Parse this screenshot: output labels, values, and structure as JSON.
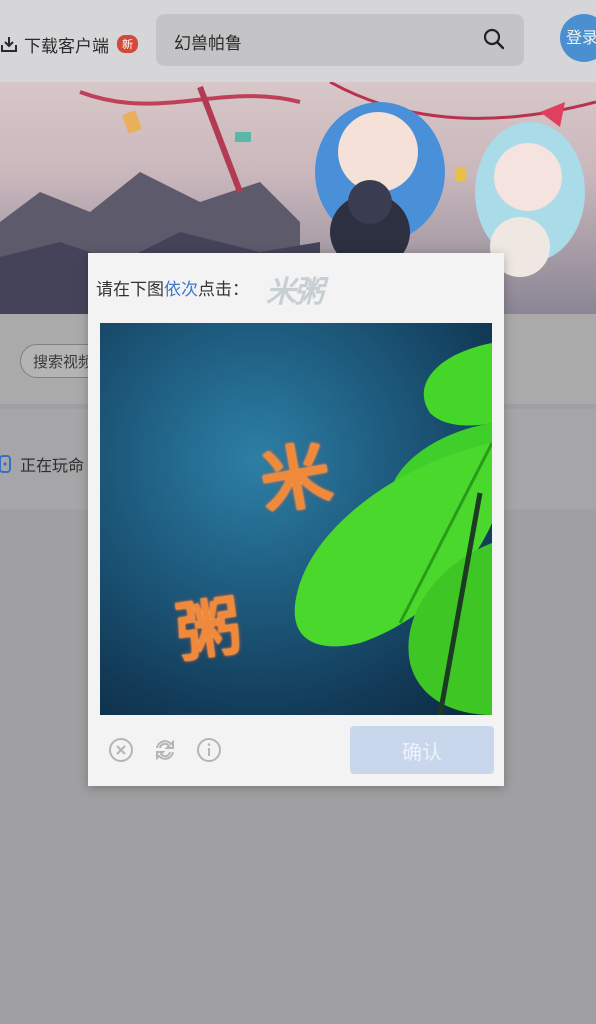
{
  "header": {
    "download_label": "下载客户端",
    "new_badge": "新",
    "search_query": "幻兽帕鲁",
    "login_label": "登录"
  },
  "page": {
    "search_pill_label": "搜索视频",
    "playing_label": "正在玩命"
  },
  "captcha": {
    "prompt_prefix": "请在下图",
    "prompt_highlight": "依次",
    "prompt_suffix": "点击：",
    "target_chars": "米粥",
    "image_chars": [
      "米",
      "粥"
    ],
    "confirm_label": "确认",
    "colors": {
      "highlight": "#3f78c8",
      "confirm_bg": "#c9d7ec"
    }
  },
  "icons": [
    "download-icon",
    "search-icon",
    "close-icon",
    "refresh-icon",
    "info-icon",
    "gamepad-icon"
  ]
}
